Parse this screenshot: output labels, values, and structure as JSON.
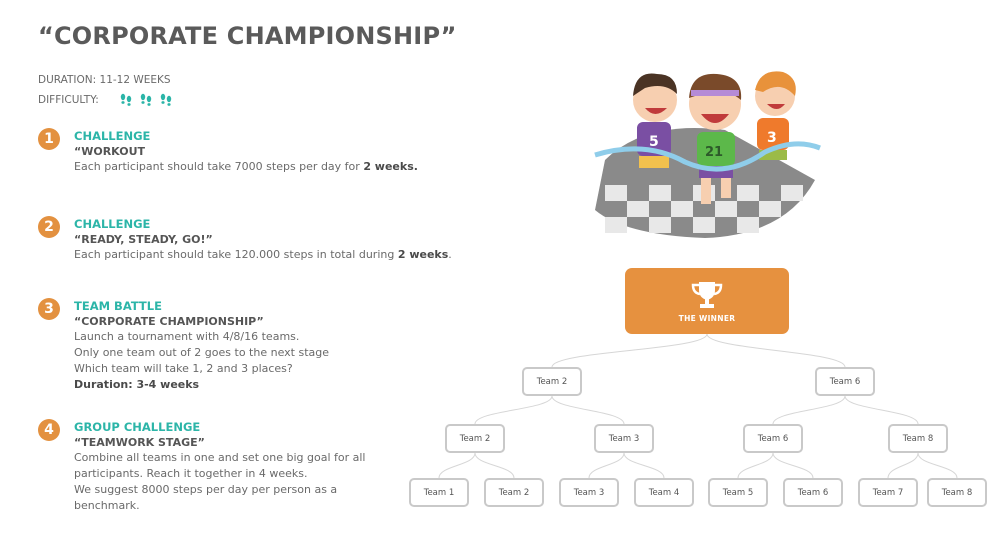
{
  "header": {
    "title": "“CORPORATE CHAMPIONSHIP”",
    "duration": "DURATION: 11-12 WEEKS",
    "difficulty_label": "DIFFICULTY:",
    "difficulty_level": 3,
    "difficulty_icon": "footprints-icon"
  },
  "colors": {
    "accent_teal": "#2cb5a8",
    "accent_orange": "#e39140",
    "text_gray": "#5a5a5a"
  },
  "steps": [
    {
      "number": "1",
      "category": "CHALLENGE",
      "subtitle": "“WORKOUT",
      "lines": [
        {
          "text": "Each participant should take 7000 steps per day for ",
          "bold": "2 weeks."
        }
      ]
    },
    {
      "number": "2",
      "category": "CHALLENGE",
      "subtitle": "“READY, STEADY, GO!”",
      "lines": [
        {
          "text": "Each participant should take 120.000 steps in total during ",
          "bold": "2 weeks",
          "after": "."
        }
      ]
    },
    {
      "number": "3",
      "category": "TEAM BATTLE",
      "subtitle": "“CORPORATE CHAMPIONSHIP”",
      "lines": [
        {
          "text": "Launch a tournament with  4/8/16 teams."
        },
        {
          "text": "Only one team out of 2 goes to the next stage"
        },
        {
          "text": "Which team will take 1, 2 and 3 places?"
        },
        {
          "text": "",
          "bold": "Duration: 3-4 weeks"
        }
      ]
    },
    {
      "number": "4",
      "category": "GROUP CHALLENGE",
      "subtitle": "“TEAMWORK STAGE”",
      "lines": [
        {
          "text": "Combine all teams in one and set one big goal for all"
        },
        {
          "text": "participants. Reach it together in 4 weeks."
        },
        {
          "text": "We suggest 8000 steps per day per person as a"
        },
        {
          "text": "benchmark."
        }
      ]
    }
  ],
  "illustration": {
    "description": "three cartoon kids running across a finish line on a checkered track",
    "jersey_numbers": [
      "5",
      "21",
      "3"
    ]
  },
  "bracket": {
    "winner_label": "THE WINNER",
    "winner_icon": "trophy-icon",
    "semifinal": [
      "Team 2",
      "Team 6"
    ],
    "quarterfinal": [
      "Team 2",
      "Team 3",
      "Team 6",
      "Team 8"
    ],
    "first_round": [
      "Team 1",
      "Team 2",
      "Team 3",
      "Team 4",
      "Team 5",
      "Team 6",
      "Team 7",
      "Team 8"
    ]
  }
}
